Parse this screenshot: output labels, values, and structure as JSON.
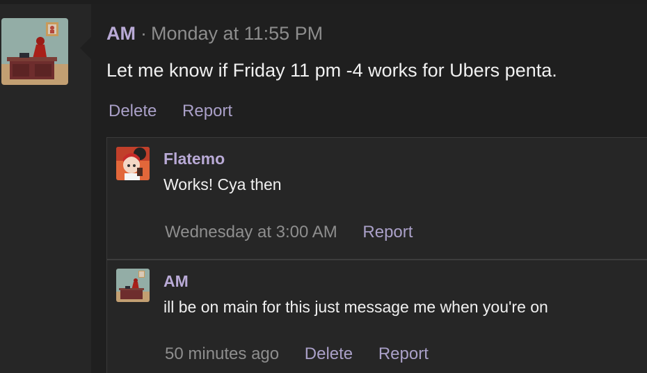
{
  "post": {
    "author": "AM",
    "separator": "·",
    "timestamp": "Monday at 11:55 PM",
    "body": "Let me know if Friday 11 pm -4 works for Ubers penta.",
    "actions": {
      "delete": "Delete",
      "report": "Report"
    }
  },
  "replies": [
    {
      "author": "Flatemo",
      "body": "Works! Cya then",
      "timestamp": "Wednesday at 3:00 AM",
      "actions": {
        "report": "Report"
      }
    },
    {
      "author": "AM",
      "body": "ill be on main for this just message me when you're on",
      "timestamp": "50 minutes ago",
      "actions": {
        "delete": "Delete",
        "report": "Report"
      }
    }
  ],
  "colors": {
    "author": "#b9aad6",
    "link": "#aaa0c8",
    "muted": "#8e8e8e",
    "text": "#f0f0f0"
  }
}
